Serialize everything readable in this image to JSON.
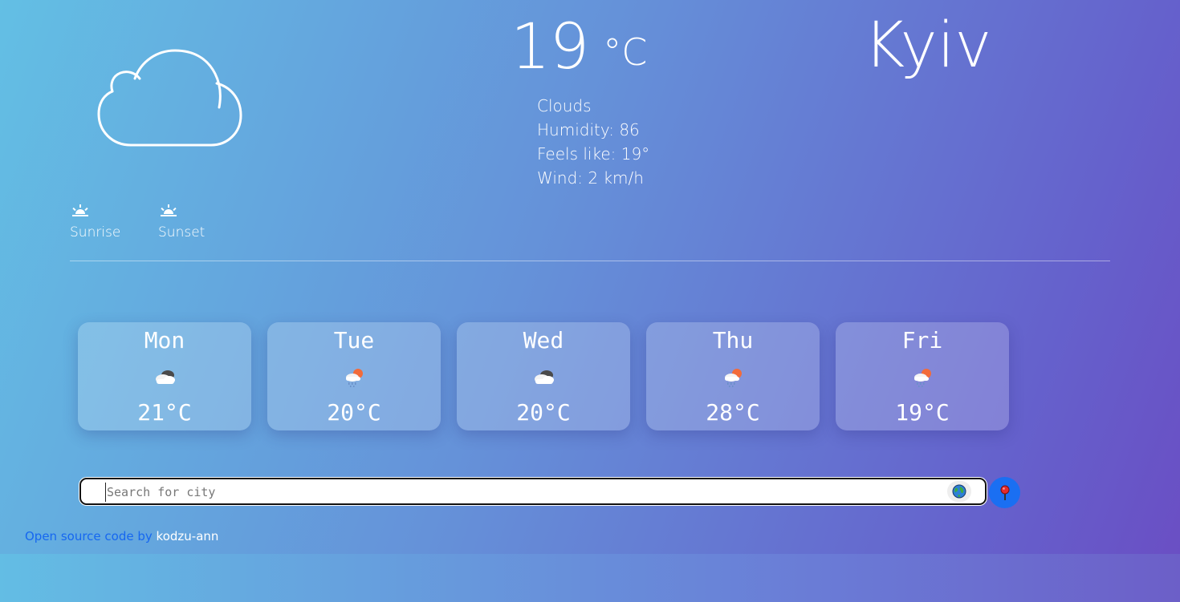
{
  "current": {
    "temperature": "19",
    "unit": "°C",
    "city": "Kyiv",
    "condition": "Clouds",
    "humidity": "Humidity: 86",
    "feels_like": "Feels like: 19°",
    "wind": "Wind: 2 km/h",
    "icon": "cloud-outline-icon"
  },
  "sun": {
    "sunrise_label": "Sunrise",
    "sunset_label": "Sunset",
    "icon": "sun-horizon-icon"
  },
  "forecast": [
    {
      "day": "Mon",
      "temp": "21°C",
      "icon": "cloudy-icon"
    },
    {
      "day": "Tue",
      "temp": "20°C",
      "icon": "sun-cloud-rain-icon"
    },
    {
      "day": "Wed",
      "temp": "20°C",
      "icon": "cloudy-icon"
    },
    {
      "day": "Thu",
      "temp": "28°C",
      "icon": "sun-cloud-rain-icon"
    },
    {
      "day": "Fri",
      "temp": "19°C",
      "icon": "sun-cloud-rain-icon"
    }
  ],
  "search": {
    "placeholder": "Search for city",
    "value": "",
    "globe_icon": "globe-icon",
    "location_icon": "pushpin-icon"
  },
  "footer": {
    "link_text": "Open source code by",
    "author": "kodzu-ann"
  },
  "colors": {
    "gradient_start": "#63bfe4",
    "gradient_end": "#6a4fc4",
    "location_button": "#1a6ff2",
    "link": "#1667f0"
  }
}
